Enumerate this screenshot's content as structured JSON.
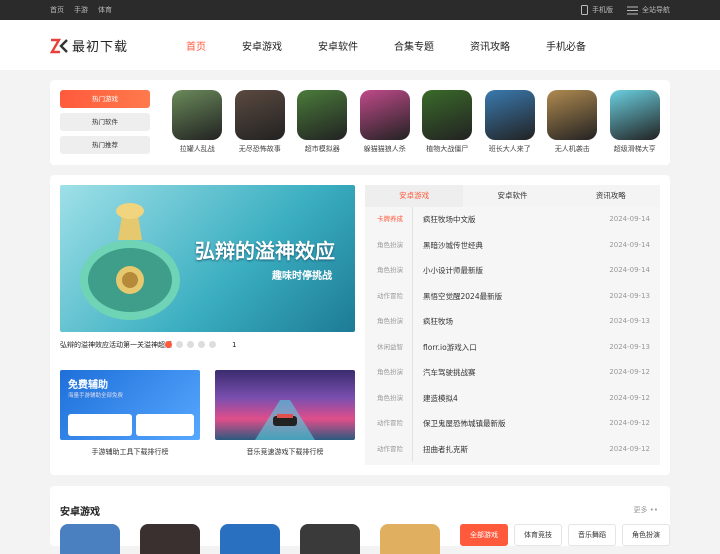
{
  "topbar": {
    "links": [
      "首页",
      "手游",
      "体育"
    ],
    "mobile": "手机版",
    "sitemap": "全站导航"
  },
  "header": {
    "logo_text": "最初下载",
    "nav": [
      "首页",
      "安卓游戏",
      "安卓软件",
      "合集专题",
      "资讯攻略",
      "手机必备"
    ]
  },
  "hot": {
    "buttons": [
      "热门游戏",
      "热门软件",
      "热门推荐"
    ],
    "apps": [
      {
        "name": "拉罐人乱战",
        "color": "#6a8a5a"
      },
      {
        "name": "无尽恐怖故事",
        "color": "#5b4a40"
      },
      {
        "name": "超市模拟器",
        "color": "#4a7b3a"
      },
      {
        "name": "躲猫猫狼人杀",
        "color": "#c04a8a"
      },
      {
        "name": "植物大战僵尸",
        "color": "#3a6a2a"
      },
      {
        "name": "班长大人来了",
        "color": "#3a7ab0"
      },
      {
        "name": "无人机袭击",
        "color": "#b08a50"
      },
      {
        "name": "超级滑梯大亨",
        "color": "#6ad0e0"
      }
    ]
  },
  "feature": {
    "banner_title": "弘辩的溢神效应",
    "banner_sub": "趣味时停挑战",
    "caption": "弘辩的溢神效应活动第一关溢神超感",
    "caption_tail": "1",
    "thumbs": [
      {
        "img_title": "免费辅助",
        "img_sub": "海量手游辅助全部免费",
        "caption": "手游辅助工具下载排行榜"
      },
      {
        "caption": "音乐竞速游戏下载排行榜"
      }
    ]
  },
  "news": {
    "tabs": [
      "安卓游戏",
      "安卓软件",
      "资讯攻略"
    ],
    "rows": [
      {
        "tag": "卡牌养成",
        "name": "疯狂牧场中文版",
        "date": "2024-09-14"
      },
      {
        "tag": "角色扮演",
        "name": "黑暗沙城传世经典",
        "date": "2024-09-14"
      },
      {
        "tag": "角色扮演",
        "name": "小小设计师最新版",
        "date": "2024-09-14"
      },
      {
        "tag": "动作冒险",
        "name": "黑悟空觉醒2024最新版",
        "date": "2024-09-13"
      },
      {
        "tag": "角色扮演",
        "name": "疯狂牧场",
        "date": "2024-09-13"
      },
      {
        "tag": "休闲益智",
        "name": "florr.io游戏入口",
        "date": "2024-09-13"
      },
      {
        "tag": "角色扮演",
        "name": "汽车驾驶挑战赛",
        "date": "2024-09-12"
      },
      {
        "tag": "角色扮演",
        "name": "建造模拟4",
        "date": "2024-09-12"
      },
      {
        "tag": "动作冒险",
        "name": "保卫鬼屋恐怖城镇最新版",
        "date": "2024-09-12"
      },
      {
        "tag": "动作冒险",
        "name": "扭曲者扎克斯",
        "date": "2024-09-12"
      }
    ]
  },
  "section": {
    "title": "安卓游戏",
    "more": "更多 ••",
    "pills": [
      "全部游戏",
      "体育竞技",
      "音乐舞蹈",
      "角色扮演"
    ]
  },
  "colors": {
    "accent": "#ff5a3c"
  }
}
